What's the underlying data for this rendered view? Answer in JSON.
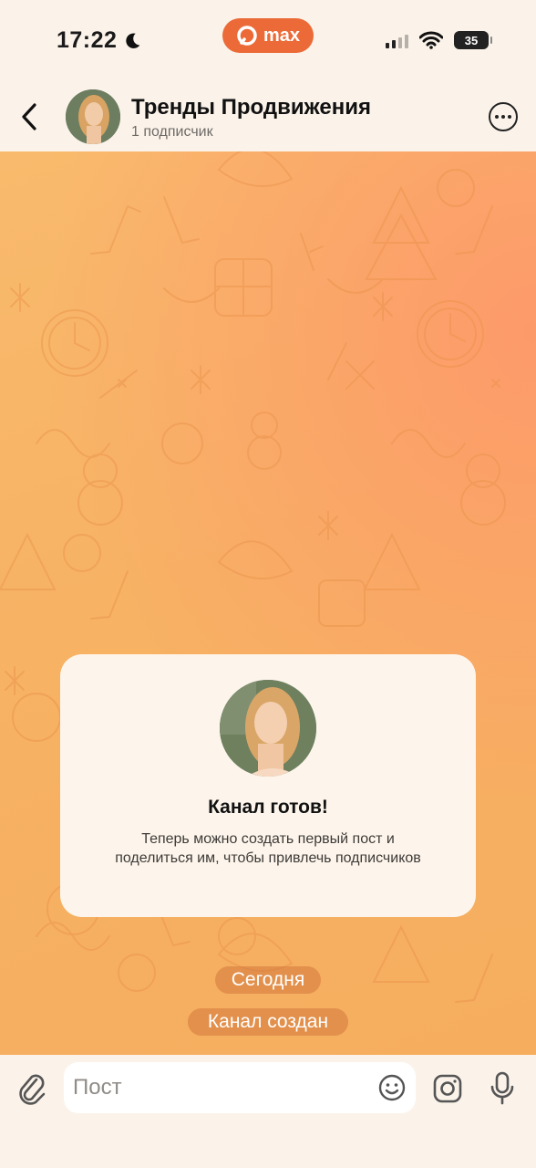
{
  "status_bar": {
    "time": "17:22",
    "app_badge": "max",
    "battery": "35"
  },
  "header": {
    "back_icon": "chevron-left-icon",
    "title": "Тренды Продвижения",
    "subtitle": "1 подписчик",
    "more_icon": "ellipsis-circle-icon"
  },
  "card": {
    "title": "Канал готов!",
    "text": "Теперь можно создать первый пост и поделиться им, чтобы привлечь подписчиков"
  },
  "system_messages": {
    "date": "Сегодня",
    "event": "Канал создан"
  },
  "composer": {
    "placeholder": "Пост",
    "icons": [
      "paperclip-icon",
      "smile-icon",
      "camera-icon",
      "microphone-icon"
    ]
  },
  "colors": {
    "accent": "#ec6a37",
    "chat_background": "#f7b264",
    "bar_background": "#fbf3ea",
    "card_background": "#fdf5ec"
  }
}
